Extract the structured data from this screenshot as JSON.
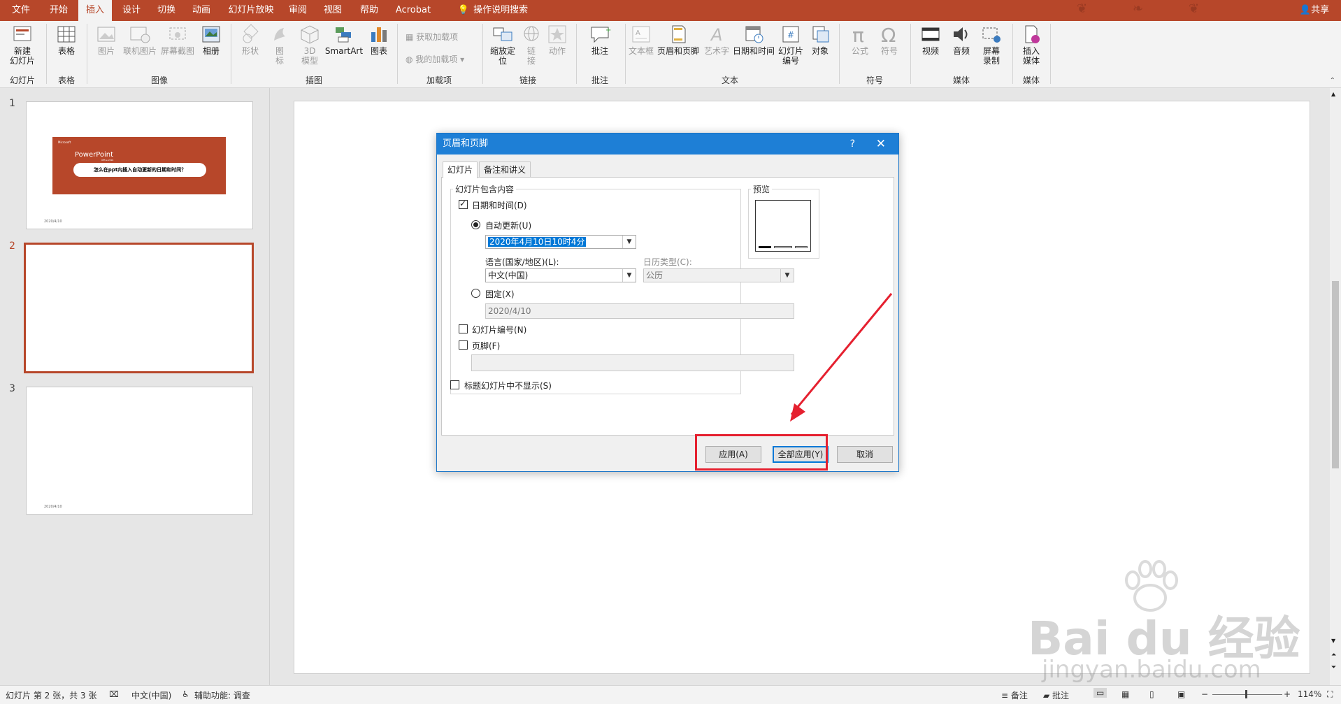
{
  "menu": {
    "tabs": [
      "文件",
      "开始",
      "插入",
      "设计",
      "切换",
      "动画",
      "幻灯片放映",
      "审阅",
      "视图",
      "帮助",
      "Acrobat"
    ],
    "active_tab": "插入",
    "search": "操作说明搜索",
    "share": "共享"
  },
  "ribbon": {
    "buttons": {
      "new_slide": "新建\n幻灯片",
      "table": "表格",
      "picture": "图片",
      "online_picture": "联机图片",
      "screenshot": "屏幕截图",
      "album": "相册",
      "shapes": "形状",
      "icons": "图\n标",
      "model3d": "3D\n模型",
      "smartart": "SmartArt",
      "chart": "图表",
      "get_addins": "获取加载项",
      "my_addins": "我的加载项",
      "zoom": "缩放定\n位",
      "link": "链\n接",
      "action": "动作",
      "comment": "批注",
      "textbox": "文本框",
      "header_footer": "页眉和页脚",
      "wordart": "艺术字",
      "datetime": "日期和时间",
      "slide_number": "幻灯片\n编号",
      "object": "对象",
      "equation": "公式",
      "symbol": "符号",
      "video": "视频",
      "audio": "音频",
      "screen_record": "屏幕\n录制",
      "insert_media": "插入\n媒体"
    },
    "groups": {
      "slides": "幻灯片",
      "tables": "表格",
      "images": "图像",
      "illustrations": "插图",
      "addins": "加载项",
      "links": "链接",
      "comments": "批注",
      "text": "文本",
      "symbols": "符号",
      "media": "媒体",
      "media2": "媒体"
    }
  },
  "slides": {
    "numbers": [
      "1",
      "2",
      "3"
    ],
    "thumb1": {
      "brand": "Microsoft",
      "title": "PowerPoint",
      "subtitle": "Office 2016",
      "caption": "怎么在ppt内插入自动更新的日期和时间？",
      "date": "2020/4/10"
    },
    "thumb3_date": "2020/4/10"
  },
  "dialog": {
    "title": "页眉和页脚",
    "help": "?",
    "close": "✕",
    "tabs": [
      "幻灯片",
      "备注和讲义"
    ],
    "group_label": "幻灯片包含内容",
    "preview_label": "预览",
    "date_time": "日期和时间(D)",
    "auto_update": "自动更新(U)",
    "auto_value": "2020年4月10日10时4分",
    "language_label": "语言(国家/地区)(L):",
    "language_value": "中文(中国)",
    "calendar_label": "日历类型(C):",
    "calendar_value": "公历",
    "fixed": "固定(X)",
    "fixed_value": "2020/4/10",
    "slide_number": "幻灯片编号(N)",
    "footer": "页脚(F)",
    "footer_value": "",
    "hide_on_title": "标题幻灯片中不显示(S)",
    "buttons": {
      "apply": "应用(A)",
      "apply_all": "全部应用(Y)",
      "cancel": "取消"
    }
  },
  "statusbar": {
    "slide_info": "幻灯片 第 2 张，共 3 张",
    "language": "中文(中国)",
    "accessibility": "辅助功能: 调查",
    "notes": "备注",
    "comments": "批注",
    "zoom": "114%"
  },
  "watermark": {
    "brand": "Bai du 经验",
    "site": "jingyan.baidu.com"
  }
}
